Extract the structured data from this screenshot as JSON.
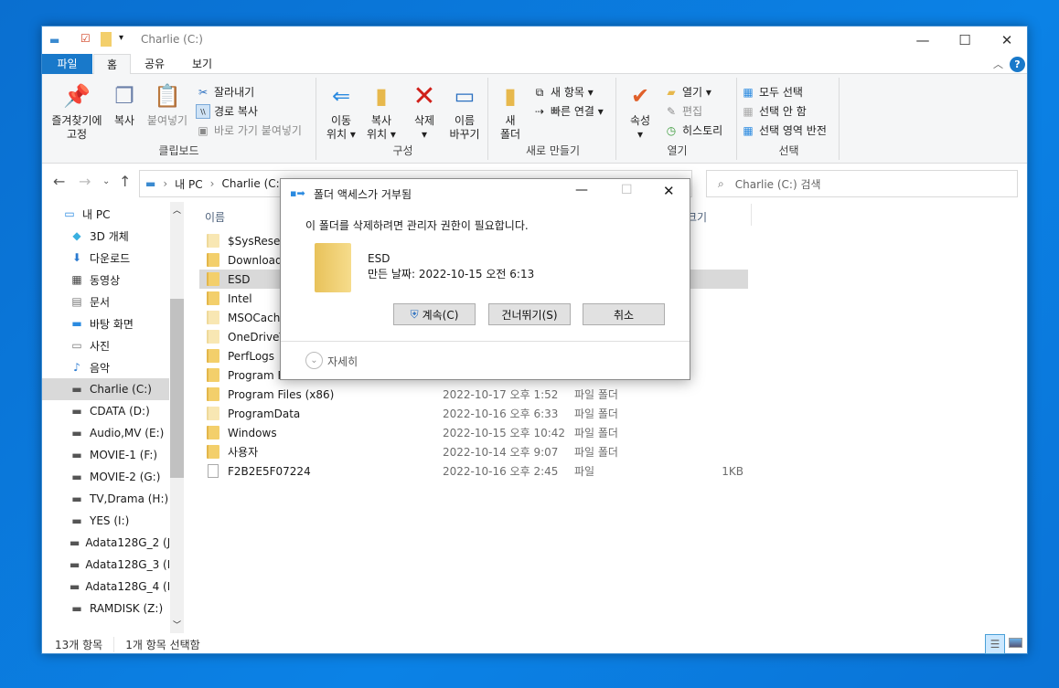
{
  "window": {
    "title": "Charlie (C:)",
    "controls": {
      "minimize": "—",
      "maximize": "☐",
      "close": "✕"
    }
  },
  "ribbon_tabs": [
    "파일",
    "홈",
    "공유",
    "보기"
  ],
  "ribbon": {
    "clipboard": {
      "label": "클립보드",
      "pin": "즐겨찾기에\n고정",
      "copy": "복사",
      "paste": "붙여넣기",
      "cut": "잘라내기",
      "copy_path": "경로 복사",
      "paste_shortcut": "바로 가기 붙여넣기"
    },
    "organize": {
      "label": "구성",
      "move": "이동\n위치 ▾",
      "copyto": "복사\n위치 ▾",
      "delete": "삭제\n▾",
      "rename": "이름\n바꾸기"
    },
    "new": {
      "label": "새로 만들기",
      "new_folder": "새\n폴더",
      "new_item": "새 항목 ▾",
      "easy_access": "빠른 연결 ▾"
    },
    "open": {
      "label": "열기",
      "properties": "속성\n▾",
      "open": "열기 ▾",
      "edit": "편집",
      "history": "히스토리"
    },
    "select": {
      "label": "선택",
      "select_all": "모두 선택",
      "select_none": "선택 안 함",
      "invert": "선택 영역 반전"
    }
  },
  "address": {
    "crumbs": [
      "내 PC",
      "Charlie (C:)"
    ],
    "search_placeholder": "Charlie (C:) 검색"
  },
  "nav": [
    {
      "label": "내 PC",
      "icon": "pc-icon"
    },
    {
      "label": "3D 개체",
      "icon": "cube-icon"
    },
    {
      "label": "다운로드",
      "icon": "download-icon"
    },
    {
      "label": "동영상",
      "icon": "video-icon"
    },
    {
      "label": "문서",
      "icon": "document-icon"
    },
    {
      "label": "바탕 화면",
      "icon": "desktop-icon"
    },
    {
      "label": "사진",
      "icon": "picture-icon"
    },
    {
      "label": "음악",
      "icon": "music-icon"
    },
    {
      "label": "Charlie (C:)",
      "icon": "drive-icon",
      "selected": true
    },
    {
      "label": "CDATA (D:)",
      "icon": "drive-icon"
    },
    {
      "label": "Audio,MV (E:)",
      "icon": "drive-icon"
    },
    {
      "label": "MOVIE-1 (F:)",
      "icon": "drive-icon"
    },
    {
      "label": "MOVIE-2 (G:)",
      "icon": "drive-icon"
    },
    {
      "label": "TV,Drama (H:)",
      "icon": "drive-icon"
    },
    {
      "label": "YES (I:)",
      "icon": "drive-icon"
    },
    {
      "label": "Adata128G_2 (J:",
      "icon": "drive-icon"
    },
    {
      "label": "Adata128G_3 (K",
      "icon": "drive-icon"
    },
    {
      "label": "Adata128G_4 (L",
      "icon": "drive-icon"
    },
    {
      "label": "RAMDISK (Z:)",
      "icon": "drive-icon"
    }
  ],
  "columns": {
    "name": "이름",
    "size": "크기"
  },
  "files": [
    {
      "name": "$SysReset",
      "date": "",
      "type": "",
      "size": "",
      "kind": "folder-hidden"
    },
    {
      "name": "Downloads",
      "date": "",
      "type": "",
      "size": "",
      "kind": "folder"
    },
    {
      "name": "ESD",
      "date": "",
      "type": "",
      "size": "",
      "kind": "folder",
      "selected": true
    },
    {
      "name": "Intel",
      "date": "",
      "type": "",
      "size": "",
      "kind": "folder"
    },
    {
      "name": "MSOCache",
      "date": "",
      "type": "",
      "size": "",
      "kind": "folder-hidden"
    },
    {
      "name": "OneDriveTemp",
      "date": "",
      "type": "",
      "size": "",
      "kind": "folder-hidden"
    },
    {
      "name": "PerfLogs",
      "date": "",
      "type": "",
      "size": "",
      "kind": "folder"
    },
    {
      "name": "Program Files",
      "date": "",
      "type": "",
      "size": "",
      "kind": "folder"
    },
    {
      "name": "Program Files (x86)",
      "date": "2022-10-17 오후 1:52",
      "type": "파일 폴더",
      "size": "",
      "kind": "folder"
    },
    {
      "name": "ProgramData",
      "date": "2022-10-16 오후 6:33",
      "type": "파일 폴더",
      "size": "",
      "kind": "folder-hidden"
    },
    {
      "name": "Windows",
      "date": "2022-10-15 오후 10:42",
      "type": "파일 폴더",
      "size": "",
      "kind": "folder"
    },
    {
      "name": "사용자",
      "date": "2022-10-14 오후 9:07",
      "type": "파일 폴더",
      "size": "",
      "kind": "folder"
    },
    {
      "name": "F2B2E5F07224",
      "date": "2022-10-16 오후 2:45",
      "type": "파일",
      "size": "1KB",
      "kind": "file"
    }
  ],
  "status": {
    "count": "13개 항목",
    "selected": "1개 항목 선택함"
  },
  "dialog": {
    "title": "폴더 액세스가 거부됨",
    "message": "이 폴더를 삭제하려면 관리자 권한이 필요합니다.",
    "item_name": "ESD",
    "item_date": "만든 날짜: 2022-10-15 오전 6:13",
    "continue": "계속(C)",
    "skip": "건너뛰기(S)",
    "cancel": "취소",
    "details": "자세히"
  },
  "colors": {
    "accent": "#1979ca",
    "selection": "#d9d9d9",
    "desktop": "#0b7ddf"
  }
}
